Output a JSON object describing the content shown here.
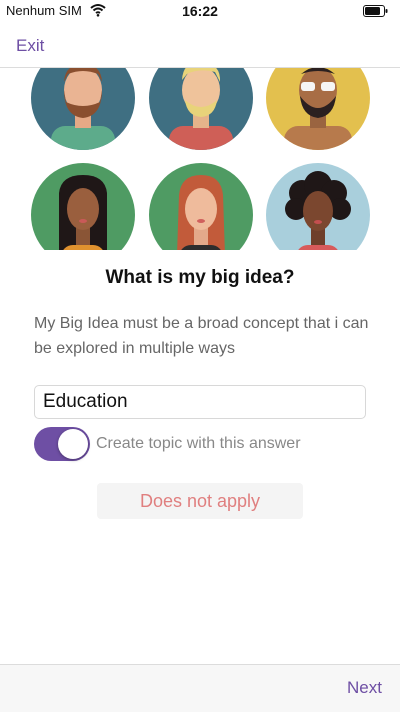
{
  "status_bar": {
    "carrier": "Nenhum SIM",
    "time": "16:22",
    "wifi_icon": "wifi-icon",
    "battery_icon": "battery-icon"
  },
  "nav": {
    "exit_label": "Exit"
  },
  "avatars": [
    {
      "name": "avatar-man-beard",
      "bg": "#3f6f82"
    },
    {
      "name": "avatar-man-blond",
      "bg": "#3f6f82"
    },
    {
      "name": "avatar-man-sunglasses",
      "bg": "#e3c04e"
    },
    {
      "name": "avatar-woman-dark-hair",
      "bg": "#4f9b63"
    },
    {
      "name": "avatar-woman-red-hair",
      "bg": "#4f9b63"
    },
    {
      "name": "avatar-woman-curly-hair",
      "bg": "#a9cfdc"
    }
  ],
  "question": {
    "title": "What is my big idea?",
    "description": "My Big Idea must be a broad concept that i can be explored in multiple ways"
  },
  "answer": {
    "value": "Education"
  },
  "toggle": {
    "label": "Create topic with this answer",
    "on": true
  },
  "does_not_apply_label": "Does not apply",
  "footer": {
    "next_label": "Next"
  },
  "colors": {
    "accent": "#6e4fa4",
    "muted_red": "#e07f7f"
  }
}
